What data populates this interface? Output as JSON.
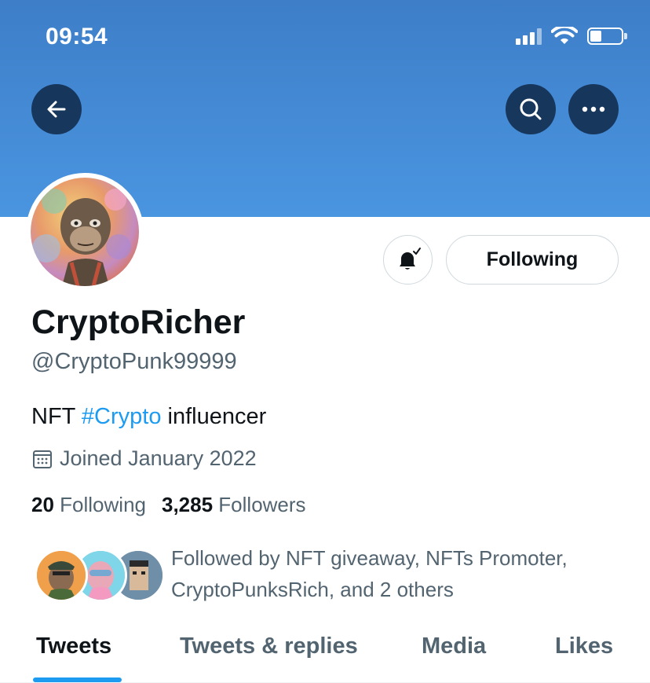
{
  "status_bar": {
    "time": "09:54",
    "icons": [
      "cellular-signal-icon",
      "wifi-icon",
      "battery-icon"
    ]
  },
  "header": {
    "back_icon": "arrow-left-icon",
    "search_icon": "search-icon",
    "more_icon": "more-horizontal-icon",
    "banner_color": "#4a95e0"
  },
  "profile": {
    "display_name": "CryptoRicher",
    "handle": "@CryptoPunk99999",
    "bio_prefix": "NFT ",
    "bio_hashtag": "#Crypto",
    "bio_suffix": " influencer",
    "joined": "Joined January 2022",
    "following_count": "20",
    "following_label": "Following",
    "followers_count": "3,285",
    "followers_label": "Followers"
  },
  "actions": {
    "bell_icon": "bell-subscribed-icon",
    "following_button": "Following"
  },
  "mutuals": {
    "text_line1": "Followed by NFT giveaway, NFTs Promoter,",
    "text_line2": "CryptoPunksRich, and 2 others"
  },
  "tabs": [
    {
      "label": "Tweets",
      "active": true
    },
    {
      "label": "Tweets & replies",
      "active": false
    },
    {
      "label": "Media",
      "active": false
    },
    {
      "label": "Likes",
      "active": false
    }
  ],
  "colors": {
    "accent": "#1d9bf0",
    "secondary_text": "#536471",
    "primary_text": "#0f1419"
  }
}
